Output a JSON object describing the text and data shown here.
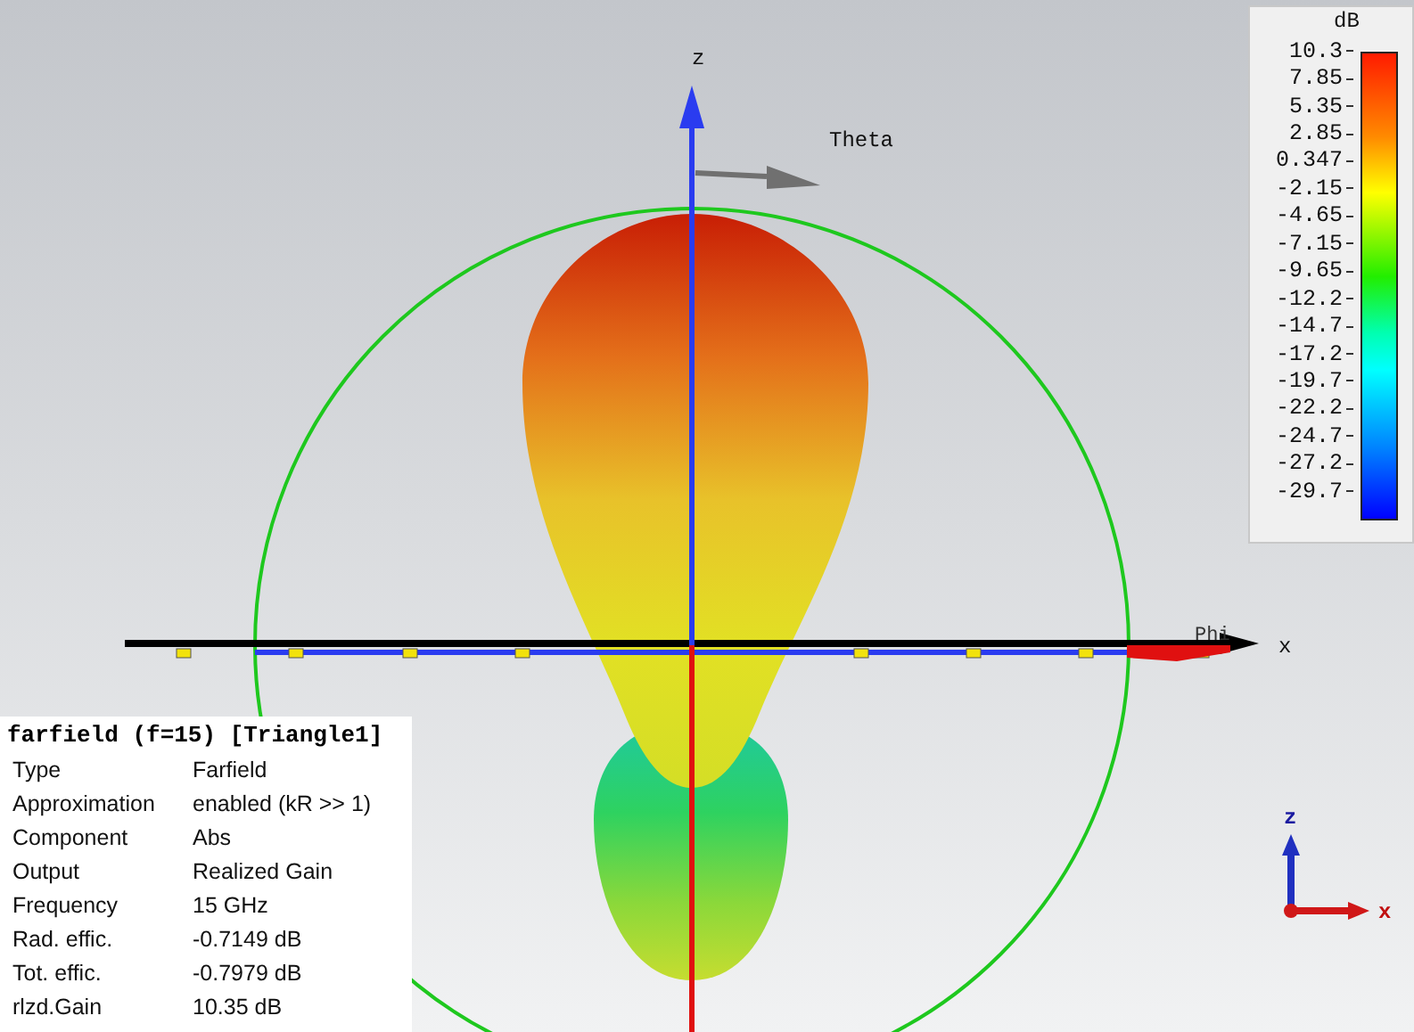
{
  "scene": {
    "axis_labels": {
      "z": "z",
      "theta": "Theta",
      "phi": "Phi",
      "x": "x"
    }
  },
  "legend": {
    "unit": "dB",
    "ticks": [
      "10.3",
      "7.85",
      "5.35",
      "2.85",
      "0.347",
      "-2.15",
      "-4.65",
      "-7.15",
      "-9.65",
      "-12.2",
      "-14.7",
      "-17.2",
      "-19.7",
      "-22.2",
      "-24.7",
      "-27.2",
      "-29.7"
    ]
  },
  "info": {
    "title": "farfield (f=15) [Triangle1]",
    "rows": [
      {
        "label": "Type",
        "value": "Farfield"
      },
      {
        "label": "Approximation",
        "value": "enabled (kR >> 1)"
      },
      {
        "label": "Component",
        "value": "Abs"
      },
      {
        "label": "Output",
        "value": "Realized Gain"
      },
      {
        "label": "Frequency",
        "value": "15 GHz"
      },
      {
        "label": "Rad. effic.",
        "value": "-0.7149 dB"
      },
      {
        "label": "Tot. effic.",
        "value": "-0.7979 dB"
      },
      {
        "label": "rlzd.Gain",
        "value": "10.35 dB"
      }
    ]
  },
  "triad": {
    "z": "z",
    "x": "x"
  }
}
